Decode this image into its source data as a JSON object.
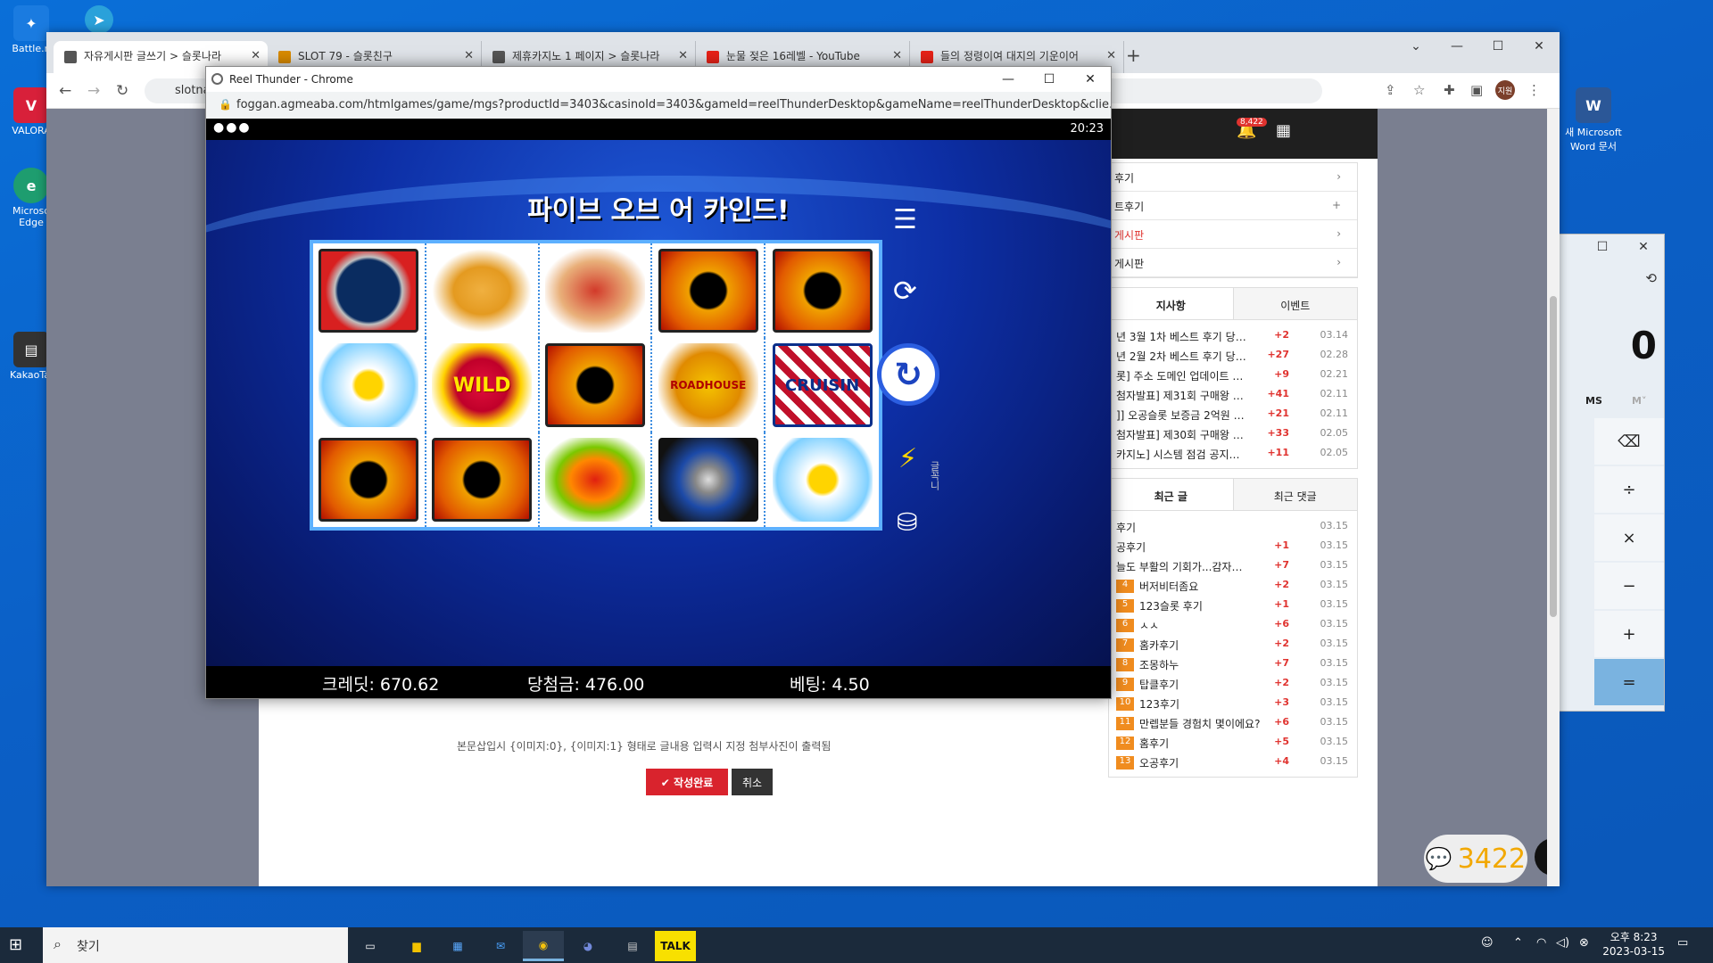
{
  "desktop": {
    "icons": [
      {
        "label": "Battle.n",
        "color": "#1a7be0"
      },
      {
        "label": "VALORA",
        "color": "#d8203a"
      },
      {
        "label": "Microso Edge",
        "color": "#1e9d6f"
      },
      {
        "label": "KakaoTal",
        "color": "#333333"
      },
      {
        "label": "새 Microsoft Word 문서",
        "color": "#2b5797"
      }
    ]
  },
  "browser": {
    "tabs": [
      {
        "title": "자유게시판 글쓰기 > 슬롯나라",
        "fav_color": "#555555"
      },
      {
        "title": "SLOT 79 - 슬롯친구",
        "fav_color": "#d88a00"
      },
      {
        "title": "제휴카지노 1 페이지 > 슬롯나라",
        "fav_color": "#555555"
      },
      {
        "title": "눈물 젖은 16레벨 - YouTube",
        "fav_color": "#e62117"
      },
      {
        "title": "들의 정령이여 대지의 기운이어",
        "fav_color": "#e62117"
      }
    ],
    "address": "slotna",
    "profile_initial": "지원"
  },
  "site": {
    "notif_count": "8,422",
    "menu": [
      {
        "label": "후기",
        "arrow": "›",
        "red": false
      },
      {
        "label": "트후기",
        "arrow": "+",
        "red": false
      },
      {
        "label": "게시판",
        "arrow": "›",
        "red": true
      },
      {
        "label": "게시판",
        "arrow": "›",
        "red": false
      }
    ],
    "notice_tabs": [
      "지사항",
      "이벤트"
    ],
    "notices": [
      {
        "title": "년 3월 1차 베스트 후기 당…",
        "count": "+2",
        "date": "03.14"
      },
      {
        "title": "년 2월 2차 베스트 후기 당…",
        "count": "+27",
        "date": "02.28"
      },
      {
        "title": "롯] 주소 도메인 업데이트 …",
        "count": "+9",
        "date": "02.21"
      },
      {
        "title": "첨자발표] 제31회 구매왕 …",
        "count": "+41",
        "date": "02.11"
      },
      {
        "title": "]] 오공슬롯 보증금 2억원 …",
        "count": "+21",
        "date": "02.11"
      },
      {
        "title": "첨자발표] 제30회 구매왕 …",
        "count": "+33",
        "date": "02.05"
      },
      {
        "title": "카지노] 시스템 점검 공지…",
        "count": "+11",
        "date": "02.05"
      }
    ],
    "recent_tabs": [
      "최근 글",
      "최근 댓글"
    ],
    "recent": [
      {
        "rank": "",
        "title": "후기",
        "count": "",
        "date": "03.15"
      },
      {
        "rank": "",
        "title": "공후기",
        "count": "+1",
        "date": "03.15"
      },
      {
        "rank": "",
        "title": "늘도 부활의 기회가...감자…",
        "count": "+7",
        "date": "03.15"
      },
      {
        "rank": "4",
        "title": "버저비터좀요",
        "count": "+2",
        "date": "03.15"
      },
      {
        "rank": "5",
        "title": "123슬롯 후기",
        "count": "+1",
        "date": "03.15"
      },
      {
        "rank": "6",
        "title": "ㅅㅅ",
        "count": "+6",
        "date": "03.15"
      },
      {
        "rank": "7",
        "title": "홈카후기",
        "count": "+2",
        "date": "03.15"
      },
      {
        "rank": "8",
        "title": "조몽하누",
        "count": "+7",
        "date": "03.15"
      },
      {
        "rank": "9",
        "title": "탑클후기",
        "count": "+2",
        "date": "03.15"
      },
      {
        "rank": "10",
        "title": "123후기",
        "count": "+3",
        "date": "03.15"
      },
      {
        "rank": "11",
        "title": "만렙분들 경험치 몇이에요?",
        "count": "+6",
        "date": "03.15"
      },
      {
        "rank": "12",
        "title": "홈후기",
        "count": "+5",
        "date": "03.15"
      },
      {
        "rank": "13",
        "title": "오공후기",
        "count": "+4",
        "date": "03.15"
      }
    ],
    "attach_note": "본문삽입시 {이미지:0}, {이미지:1} 형태로 글내용 입력시 지정 첨부사진이 출력됨",
    "submit_label": "✔ 작성완료",
    "cancel_label": "취소",
    "chat_count": "3422"
  },
  "calculator": {
    "display": "0",
    "mem_labels": [
      "MS",
      "M˅"
    ],
    "keys": [
      "⌫",
      "÷",
      "×",
      "−",
      "+",
      "="
    ]
  },
  "popup": {
    "title": "Reel Thunder - Chrome",
    "url": "foggan.agmeaba.com/htmlgames/game/mgs?productId=3403&casinoId=3403&gameId=reelThunderDesktop&gameName=reelThunderDesktop&clie...",
    "time": "20:23",
    "headline": "파이브 오브 어 카인드!",
    "reels": [
      [
        "gauge",
        "pancake",
        "hotdog",
        "thunder",
        "thunder"
      ],
      [
        "egg",
        "wild",
        "thunder",
        "roadhouse",
        "cruisin"
      ],
      [
        "thunder",
        "thunder",
        "chili",
        "bike",
        "egg"
      ]
    ],
    "symbol_text": {
      "gauge": "",
      "pancake": "",
      "hotdog": "",
      "thunder": "",
      "egg": "",
      "wild": "WILD",
      "roadhouse": "ROADHOUSE",
      "cruisin": "CRUISIN",
      "chili": "",
      "bike": ""
    },
    "side_label": "글꼭니",
    "credit": "크레딧: 670.62",
    "win": "당첨금: 476.00",
    "bet": "베팅: 4.50"
  },
  "taskbar": {
    "search_placeholder": "찾기",
    "time": "오후 8:23",
    "date": "2023-03-15"
  }
}
